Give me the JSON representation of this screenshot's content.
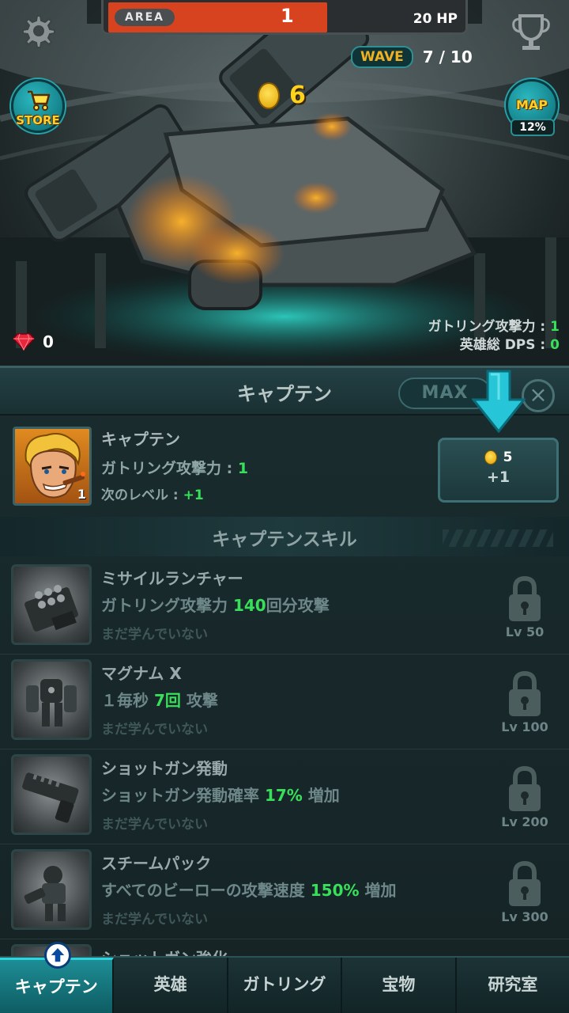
{
  "hud": {
    "area_label": "AREA",
    "area_number": "1",
    "hp_text": "20 HP",
    "area_progress": 0.62,
    "wave_label": "WAVE",
    "wave_count": "7 / 10"
  },
  "currency": {
    "coins": "6",
    "gems": "0"
  },
  "store": {
    "label": "STORE"
  },
  "map": {
    "label": "MAP",
    "progress": "12%"
  },
  "stats": {
    "gatling_label": "ガトリング攻撃力 : ",
    "gatling_value": "1",
    "dps_label": "英雄総 DPS : ",
    "dps_value": "0"
  },
  "panel": {
    "title": "キャプテン",
    "max_label": "MAX",
    "close_icon": "close-icon"
  },
  "captain": {
    "level": "1",
    "name": "キャプテン",
    "attack_label": "ガトリング攻撃力 : ",
    "attack_value": "1",
    "next_label": "次のレベル : ",
    "next_value": "+1",
    "upgrade_cost": "5",
    "upgrade_gain": "+1"
  },
  "skills_header": "キャプテンスキル",
  "skills": [
    {
      "name": "ミサイルランチャー",
      "desc_pre": "ガトリング攻撃力 ",
      "desc_hl": "140",
      "desc_post": "回分攻撃",
      "status": "まだ学んでいない",
      "lock_level": "Lv 50"
    },
    {
      "name": "マグナム X",
      "desc_pre": "１毎秒 ",
      "desc_hl": "7回",
      "desc_post": " 攻撃",
      "status": "まだ学んでいない",
      "lock_level": "Lv 100"
    },
    {
      "name": "ショットガン発動",
      "desc_pre": "ショットガン発動確率 ",
      "desc_hl": "17%",
      "desc_post": " 増加",
      "status": "まだ学んでいない",
      "lock_level": "Lv 200"
    },
    {
      "name": "スチームパック",
      "desc_pre": "すべてのビーローの攻撃速度 ",
      "desc_hl": "150%",
      "desc_post": " 増加",
      "status": "まだ学んでいない",
      "lock_level": "Lv 300"
    },
    {
      "name": "ショットガン強化",
      "desc_pre": "",
      "desc_hl": "",
      "desc_post": "",
      "status": "",
      "lock_level": ""
    }
  ],
  "nav": {
    "tabs": [
      "キャプテン",
      "英雄",
      "ガトリング",
      "宝物",
      "研究室"
    ],
    "active_index": 0
  },
  "colors": {
    "accent": "#1e8d95",
    "highlight_green": "#38e05a",
    "hp_bar": "#d8431f",
    "coin": "#ffd21e"
  }
}
